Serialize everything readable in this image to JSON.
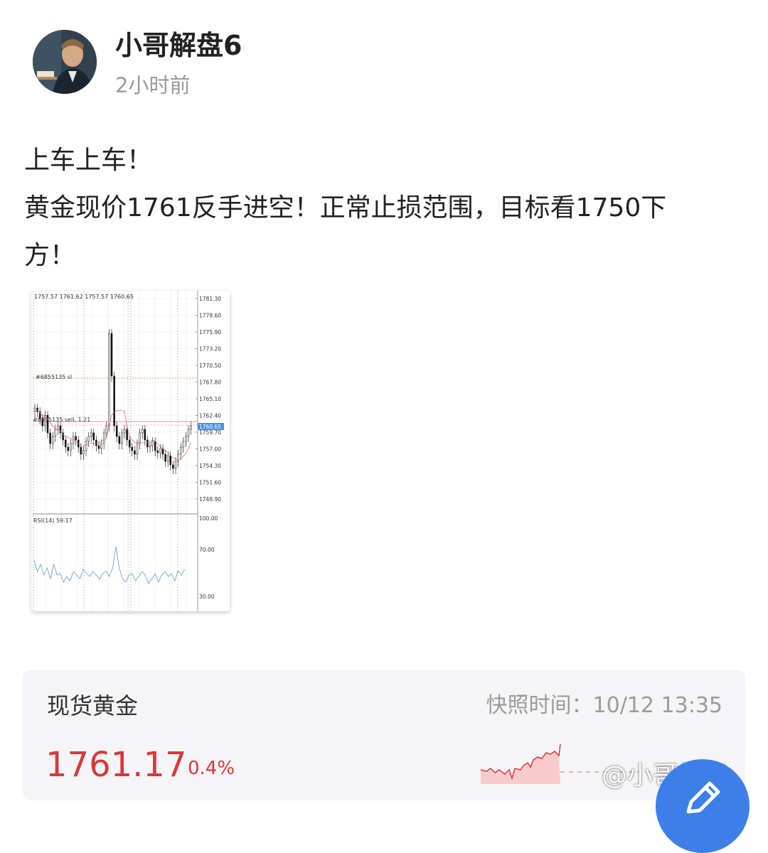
{
  "post": {
    "author_name": "小哥解盘6",
    "time": "2小时前",
    "lines": [
      "上车上车！",
      "黄金现价1761反手进空！正常止损范围，目标看1750下",
      "方！"
    ]
  },
  "chart_image": {
    "ohlc_label": "1757.57 1761.62 1757.57 1760.65",
    "sl_label": "#6855135 sl",
    "order_label": "#6855135 sell, 1.21",
    "current_price_tag": "1760.65",
    "price_ticks": [
      "1781.30",
      "1778.60",
      "1775.90",
      "1773.20",
      "1770.50",
      "1767.80",
      "1765.10",
      "1762.40",
      "1759.70",
      "1757.00",
      "1754.30",
      "1751.60",
      "1748.90"
    ],
    "rsi_label": "RSI(14) 59.17",
    "rsi_ticks": [
      "100.00",
      "70.00",
      "30.00"
    ],
    "colors": {
      "price_tag_bg": "#4a90e2",
      "ma_line": "#e07070",
      "rsi_line": "#5b9bd5",
      "order_line": "#d99a9a"
    }
  },
  "quote": {
    "name": "现货黄金",
    "snapshot": "快照时间：10/12 13:35",
    "price": "1761.17",
    "change": "0.4%",
    "colors": {
      "price": "#d9383b",
      "spark_fill": "#f7c6c7",
      "spark_line": "#d9383b"
    }
  },
  "watermark": "@小哥解盘",
  "icons": {
    "fab": "edit-pencil-icon",
    "avatar": "user-avatar"
  }
}
